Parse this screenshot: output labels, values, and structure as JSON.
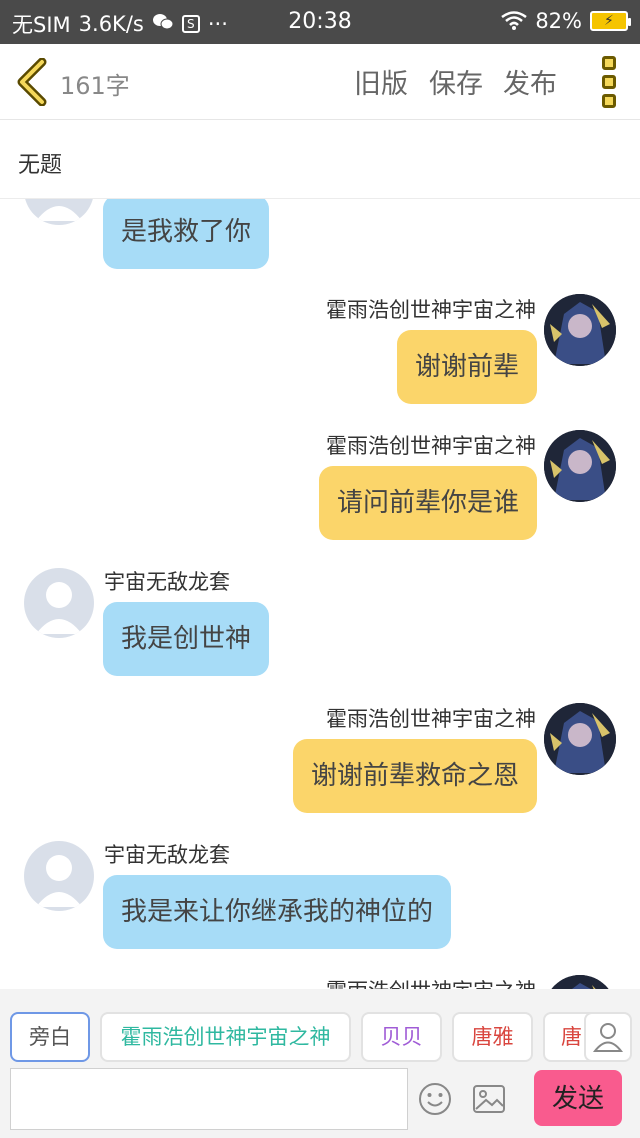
{
  "status_bar": {
    "carrier": "无SIM",
    "speed": "3.6K/s",
    "chat_icon": "wechat-icon",
    "box_icon_char": "S",
    "dots": "···",
    "time": "20:38",
    "battery": "82%"
  },
  "nav": {
    "char_count": "161字",
    "old_version": "旧版",
    "save": "保存",
    "publish": "发布"
  },
  "title": "无题",
  "messages": [
    {
      "side": "left",
      "name": "",
      "text": "是我救了你"
    },
    {
      "side": "right",
      "name": "霍雨浩创世神宇宙之神",
      "text": "谢谢前辈"
    },
    {
      "side": "right",
      "name": "霍雨浩创世神宇宙之神",
      "text": "请问前辈你是谁"
    },
    {
      "side": "left",
      "name": "宇宙无敌龙套",
      "text": "我是创世神"
    },
    {
      "side": "right",
      "name": "霍雨浩创世神宇宙之神",
      "text": "谢谢前辈救命之恩"
    },
    {
      "side": "left",
      "name": "宇宙无敌龙套",
      "text": "我是来让你继承我的神位的"
    },
    {
      "side": "right",
      "name": "霍雨浩创世神宇宙之神",
      "text": ""
    }
  ],
  "speakers": [
    {
      "label": "旁白",
      "color": "#555555",
      "selected": true
    },
    {
      "label": "霍雨浩创世神宇宙之神",
      "color": "#2fb8a0"
    },
    {
      "label": "贝贝",
      "color": "#a05cd6"
    },
    {
      "label": "唐雅",
      "color": "#d9453e"
    },
    {
      "label": "唐",
      "color": "#d9453e"
    }
  ],
  "input": {
    "value": "",
    "placeholder": ""
  },
  "send_label": "发送",
  "colors": {
    "bubble_left": "#a7dcf7",
    "bubble_right": "#fbd56a",
    "send_button": "#f95b8e",
    "accent": "#f5c400"
  }
}
